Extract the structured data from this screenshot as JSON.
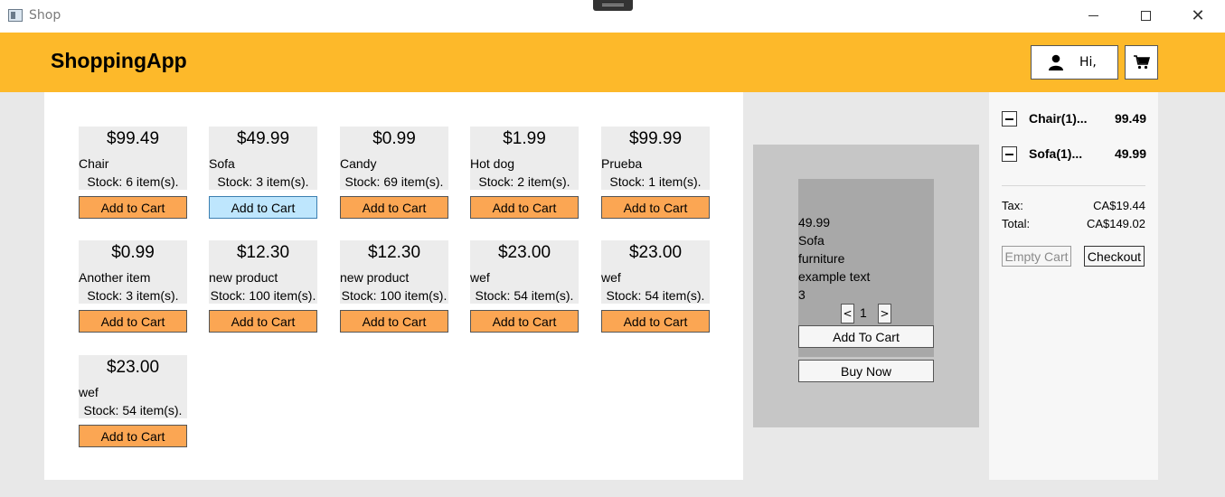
{
  "window": {
    "title": "Shop",
    "minimize_icon": "minimize-icon",
    "maximize_icon": "maximize-icon",
    "close_icon": "close-icon",
    "close_glyph": "✕"
  },
  "header": {
    "brand": "ShoppingApp",
    "greeting": "Hi,",
    "background": "#fdb92a",
    "user_icon": "user-icon",
    "cart_icon": "cart-icon"
  },
  "products": [
    {
      "price": "$99.49",
      "name": "Chair",
      "stock": "Stock: 6 item(s).",
      "button": "Add to Cart"
    },
    {
      "price": "$49.99",
      "name": "Sofa",
      "stock": "Stock: 3 item(s).",
      "button": "Add to Cart"
    },
    {
      "price": "$0.99",
      "name": "Candy",
      "stock": "Stock: 69 item(s).",
      "button": "Add to Cart"
    },
    {
      "price": "$1.99",
      "name": "Hot dog",
      "stock": "Stock: 2 item(s).",
      "button": "Add to Cart"
    },
    {
      "price": "$99.99",
      "name": "Prueba",
      "stock": "Stock: 1 item(s).",
      "button": "Add to Cart"
    },
    {
      "price": "$0.99",
      "name": "Another item",
      "stock": "Stock: 3 item(s).",
      "button": "Add to Cart"
    },
    {
      "price": "$12.30",
      "name": "new product",
      "stock": "Stock: 100 item(s).",
      "button": "Add to Cart"
    },
    {
      "price": "$12.30",
      "name": "new product",
      "stock": "Stock: 100 item(s).",
      "button": "Add to Cart"
    },
    {
      "price": "$23.00",
      "name": "wef",
      "stock": "Stock: 54 item(s).",
      "button": "Add to Cart"
    },
    {
      "price": "$23.00",
      "name": "wef",
      "stock": "Stock: 54 item(s).",
      "button": "Add to Cart"
    },
    {
      "price": "$23.00",
      "name": "wef",
      "stock": "Stock: 54 item(s).",
      "button": "Add to Cart"
    }
  ],
  "detail": {
    "price": "49.99",
    "name": "Sofa",
    "category": "furniture",
    "description": "example text",
    "stock": "3",
    "decrement": "<",
    "quantity": "1",
    "increment": ">",
    "add_button": "Add To Cart",
    "buy_button": "Buy Now"
  },
  "cart": {
    "items": [
      {
        "name": "Chair(1)...",
        "price": "99.49"
      },
      {
        "name": "Sofa(1)...",
        "price": "49.99"
      }
    ],
    "tax_label": "Tax:",
    "tax_value": "CA$19.44",
    "total_label": "Total:",
    "total_value": "CA$149.02",
    "empty_button": "Empty Cart",
    "checkout_button": "Checkout"
  }
}
